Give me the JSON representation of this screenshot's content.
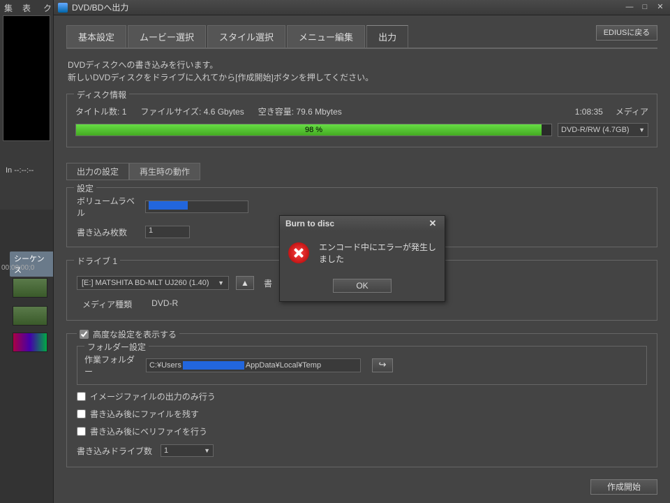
{
  "bg": {
    "menu": [
      "集",
      "表示",
      "ク"
    ],
    "inout": "In --:--:--",
    "seq": "シーケンス",
    "tc": "00:00:00;0"
  },
  "window": {
    "title": "DVD/BDへ出力",
    "tabs": [
      "基本設定",
      "ムービー選択",
      "スタイル選択",
      "メニュー編集",
      "出力"
    ],
    "active_tab": 4,
    "return_btn": "EDIUSに戻る",
    "desc_line1": "DVDディスクへの書き込みを行います。",
    "desc_line2": "新しいDVDディスクをドライブに入れてから[作成開始]ボタンを押してください。"
  },
  "disc": {
    "group": "ディスク情報",
    "titles_label": "タイトル数:",
    "titles_val": "1",
    "filesize_label": "ファイルサイズ:",
    "filesize_val": "4.6 Gbytes",
    "free_label": "空き容量:",
    "free_val": "79.6 Mbytes",
    "duration": "1:08:35",
    "media_label": "メディア",
    "progress_pct": "98 %",
    "media_sel": "DVD-R/RW (4.7GB)"
  },
  "subtabs": [
    "出力の設定",
    "再生時の動作"
  ],
  "settings": {
    "group": "設定",
    "vol_label": "ボリュームラベル",
    "copies_label": "書き込み枚数",
    "copies_val": "1"
  },
  "drive": {
    "group": "ドライブ 1",
    "sel": "[E:] MATSHITA BD-MLT UJ260 (1.40)",
    "eject": "▲",
    "write_label": "書",
    "mediatype_label": "メディア種類",
    "mediatype_val": "DVD-R"
  },
  "adv": {
    "show_adv": "高度な設定を表示する",
    "folder_group": "フォルダー設定",
    "workfolder_label": "作業フォルダー",
    "path_pre": "C:¥Users",
    "path_post": "AppData¥Local¥Temp",
    "chk_image": "イメージファイルの出力のみ行う",
    "chk_keep": "書き込み後にファイルを残す",
    "chk_verify": "書き込み後にベリファイを行う",
    "drives_label": "書き込みドライブ数",
    "drives_val": "1"
  },
  "footer": {
    "start": "作成開始"
  },
  "dialog": {
    "title": "Burn to disc",
    "msg": "エンコード中にエラーが発生しました",
    "ok": "OK"
  }
}
